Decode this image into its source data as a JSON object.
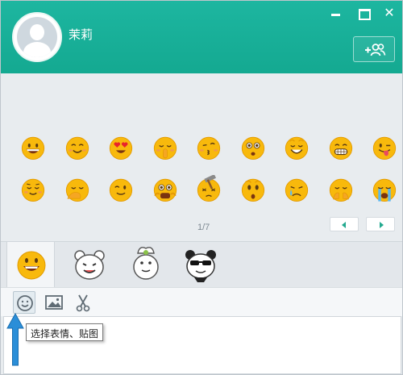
{
  "header": {
    "username": "茉莉",
    "add_friend_icon": "add-friend-icon"
  },
  "window_controls": [
    "minimize",
    "maximize",
    "close"
  ],
  "chat": {
    "ghost_text": ""
  },
  "emoji_panel": {
    "row1": [
      "grin",
      "smile",
      "heart-eyes",
      "shush",
      "kiss",
      "surprised",
      "smirk",
      "grimace",
      "tongue-wink"
    ],
    "row2": [
      "relieved",
      "facepalm",
      "wink",
      "scared",
      "hammer-hit",
      "shocked",
      "cry",
      "cover-mouth",
      "sob"
    ],
    "pager": "1/7"
  },
  "sticker_tabs": [
    "emoji",
    "bear",
    "chef-dumpling",
    "panda"
  ],
  "toolbar": {
    "emoji_button": "smiley-icon",
    "image_button": "image-icon",
    "screenshot_button": "scissors-icon"
  },
  "tooltip": "选择表情、贴图",
  "colors": {
    "header": "#14a991",
    "accent": "#22a98f",
    "emoji_yellow": "#f8b90c",
    "arrow": "#2b8ed8"
  }
}
